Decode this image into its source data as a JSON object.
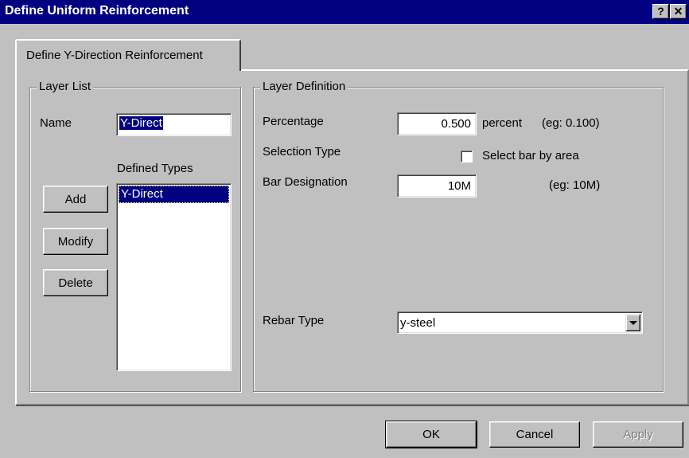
{
  "window": {
    "title": "Define Uniform Reinforcement",
    "help_label": "?",
    "close_label": "✕"
  },
  "tab": {
    "label": "Define Y-Direction Reinforcement"
  },
  "layer_list": {
    "legend": "Layer List",
    "name_label": "Name",
    "name_value": "Y-Direct",
    "defined_types_label": "Defined Types",
    "defined_types": [
      "Y-Direct"
    ],
    "add_label": "Add",
    "modify_label": "Modify",
    "delete_label": "Delete"
  },
  "layer_definition": {
    "legend": "Layer Definition",
    "percentage_label": "Percentage",
    "percentage_value": "0.500",
    "percentage_unit": "percent",
    "percentage_hint": "(eg: 0.100)",
    "selection_type_label": "Selection Type",
    "select_by_area_label": "Select bar by area",
    "select_by_area_checked": false,
    "bar_designation_label": "Bar Designation",
    "bar_designation_value": "10M",
    "bar_designation_hint": "(eg: 10M)",
    "rebar_type_label": "Rebar Type",
    "rebar_type_value": "y-steel"
  },
  "footer": {
    "ok_label": "OK",
    "cancel_label": "Cancel",
    "apply_label": "Apply"
  },
  "colors": {
    "title_bar": "#000080",
    "face": "#c0c0c0",
    "selection": "#000080"
  }
}
